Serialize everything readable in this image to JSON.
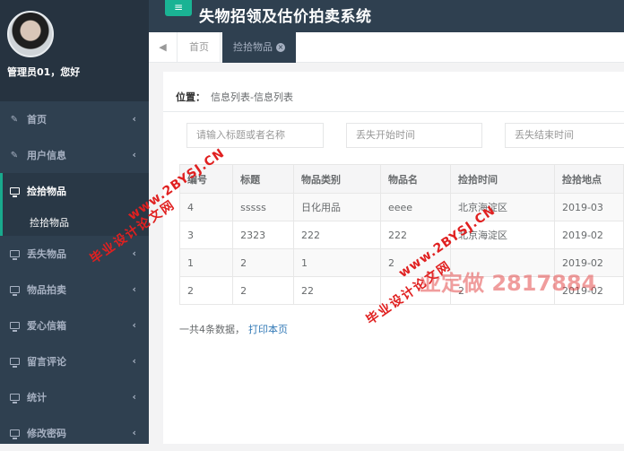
{
  "app": {
    "title": "失物招领及估价拍卖系统"
  },
  "profile": {
    "greeting": "管理员01，您好"
  },
  "sidebar": {
    "items": [
      {
        "label": "首页",
        "icon": "edit-icon"
      },
      {
        "label": "用户信息",
        "icon": "edit-icon"
      },
      {
        "label": "捡拾物品",
        "icon": "monitor-icon",
        "active": true,
        "subitems": [
          {
            "label": "捡拾物品"
          }
        ]
      },
      {
        "label": "丢失物品",
        "icon": "monitor-icon"
      },
      {
        "label": "物品拍卖",
        "icon": "monitor-icon"
      },
      {
        "label": "爱心信箱",
        "icon": "monitor-icon"
      },
      {
        "label": "留言评论",
        "icon": "monitor-icon"
      },
      {
        "label": "统计",
        "icon": "monitor-icon"
      },
      {
        "label": "修改密码",
        "icon": "monitor-icon"
      }
    ]
  },
  "tabs": {
    "home": "首页",
    "active": "捡拾物品"
  },
  "breadcrumb": {
    "label": "位置：",
    "path": "信息列表-信息列表"
  },
  "filters": {
    "keyword_placeholder": "请输入标题或者名称",
    "start_placeholder": "丢失开始时间",
    "end_placeholder": "丢失结束时间"
  },
  "table": {
    "headers": [
      "编号",
      "标题",
      "物品类别",
      "物品名",
      "捡拾时间",
      "捡拾地点"
    ],
    "rows": [
      [
        "4",
        "sssss",
        "日化用品",
        "eeee",
        "北京海淀区",
        "2019-03"
      ],
      [
        "3",
        "2323",
        "222",
        "222",
        "北京海淀区",
        "2019-02"
      ],
      [
        "1",
        "2",
        "1",
        "2",
        "",
        "2019-02"
      ],
      [
        "2",
        "2",
        "22",
        "",
        "2",
        "2019-02"
      ]
    ]
  },
  "summary": {
    "count_text": "一共4条数据，",
    "print_link": "打印本页"
  },
  "watermarks": {
    "site1": "www.2BYSJ.CN",
    "name1": "毕业设计论文网",
    "site2": "www.2BYSJ.CN",
    "name2": "毕业设计论文网",
    "custom": "业定做 2817884"
  },
  "colors": {
    "sidebar": "#2f4050",
    "accent": "#1ab394",
    "link": "#337ab7"
  }
}
